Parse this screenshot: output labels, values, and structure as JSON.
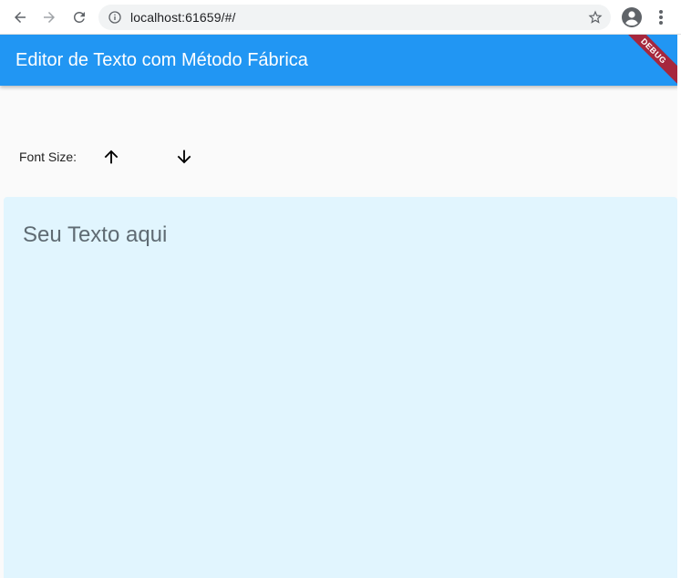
{
  "browser": {
    "url": "localhost:61659/#/",
    "icons": {
      "back": "back-arrow-icon",
      "forward": "forward-arrow-icon",
      "reload": "reload-icon",
      "info": "info-icon",
      "bookmark": "star-icon",
      "profile": "account-icon",
      "menu": "more-vert-icon"
    }
  },
  "app": {
    "title": "Editor de Texto com Método Fábrica",
    "debug_banner": "DEBUG",
    "font_size_label": "Font Size:",
    "increase_icon": "arrow-up-icon",
    "decrease_icon": "arrow-down-icon",
    "text_placeholder": "Seu Texto aqui",
    "colors": {
      "appbar": "#2196f3",
      "background": "#fafafa",
      "text_area": "#e1f5fe",
      "debug_banner": "#a6273d"
    }
  }
}
